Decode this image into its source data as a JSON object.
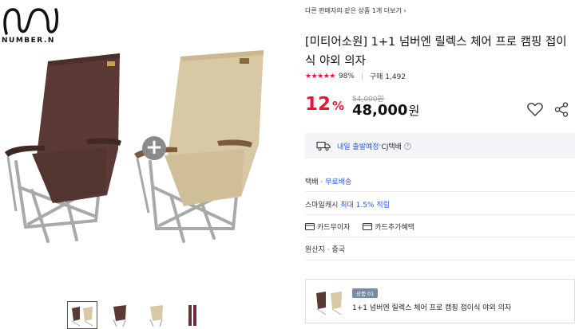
{
  "brand": {
    "logo_text": "NUMBER.N"
  },
  "gallery": {
    "plus_symbol": "+",
    "thumbnail_count": 4,
    "active_thumbnail": 1
  },
  "product": {
    "seller_link": "다른 판매자의 같은 상품 1개 더보기",
    "title": "[미티어소원] 1+1 넘버엔 릴렉스 체어 프로 캠핑 접이식 야외 의자",
    "rating_stars": "★★★★★",
    "rating_percent": "98%",
    "purchase_count": "구매 1,492",
    "discount_value": "12",
    "discount_unit": "%",
    "original_price": "54,000원",
    "sale_price": "48,000",
    "sale_unit": "원"
  },
  "delivery": {
    "schedule": "내일 출발예정",
    "separator": " · ",
    "carrier": "CJ택배",
    "help": "?"
  },
  "shipping": {
    "label": "택배 · ",
    "value": "무료배송"
  },
  "points": {
    "label": "스마일캐시 ",
    "value": "최대 1.5% 적립"
  },
  "cards": {
    "no_interest": "카드무이자",
    "extra_benefit": "카드추가혜택"
  },
  "origin": {
    "label": "원산지 · ",
    "value": "중국"
  },
  "option": {
    "badge": "상품 01",
    "name": "1+1 넘버엔 릴렉스 체어 프로 캠핑 접이식 야외 의자"
  },
  "colors": {
    "accent_red": "#e8143a",
    "accent_blue": "#2b57d9",
    "chair_brown": "#5b3a35",
    "chair_beige": "#d9c8a4",
    "frame_silver": "#a9a9a9"
  }
}
